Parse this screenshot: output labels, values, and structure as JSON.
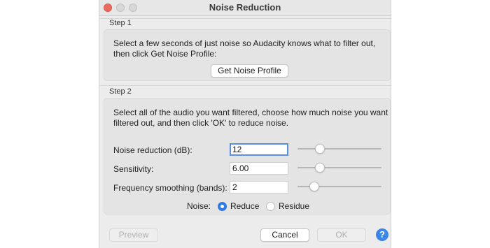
{
  "window": {
    "title": "Noise Reduction"
  },
  "step1": {
    "label": "Step 1",
    "instructions_line1": "Select a few seconds of just noise so Audacity knows what to filter out,",
    "instructions_line2": "then click Get Noise Profile:",
    "get_profile_label": "Get Noise Profile"
  },
  "step2": {
    "label": "Step 2",
    "instructions_line1": "Select all of the audio you want filtered, choose how much noise you want",
    "instructions_line2": "filtered out, and then click 'OK' to reduce noise.",
    "noise_reduction": {
      "label": "Noise reduction (dB):",
      "value": "12",
      "slider_fraction": 0.27
    },
    "sensitivity": {
      "label": "Sensitivity:",
      "value": "6.00",
      "slider_fraction": 0.27
    },
    "frequency_smoothing": {
      "label": "Frequency smoothing (bands):",
      "value": "2",
      "slider_fraction": 0.2
    },
    "noise": {
      "label": "Noise:",
      "options": [
        {
          "label": "Reduce",
          "selected": true
        },
        {
          "label": "Residue",
          "selected": false
        }
      ]
    }
  },
  "buttons": {
    "preview": "Preview",
    "cancel": "Cancel",
    "ok": "OK",
    "help": "?"
  },
  "colors": {
    "accent": "#2f7ae5",
    "close": "#ed6a5e",
    "help": "#3b86e8"
  }
}
